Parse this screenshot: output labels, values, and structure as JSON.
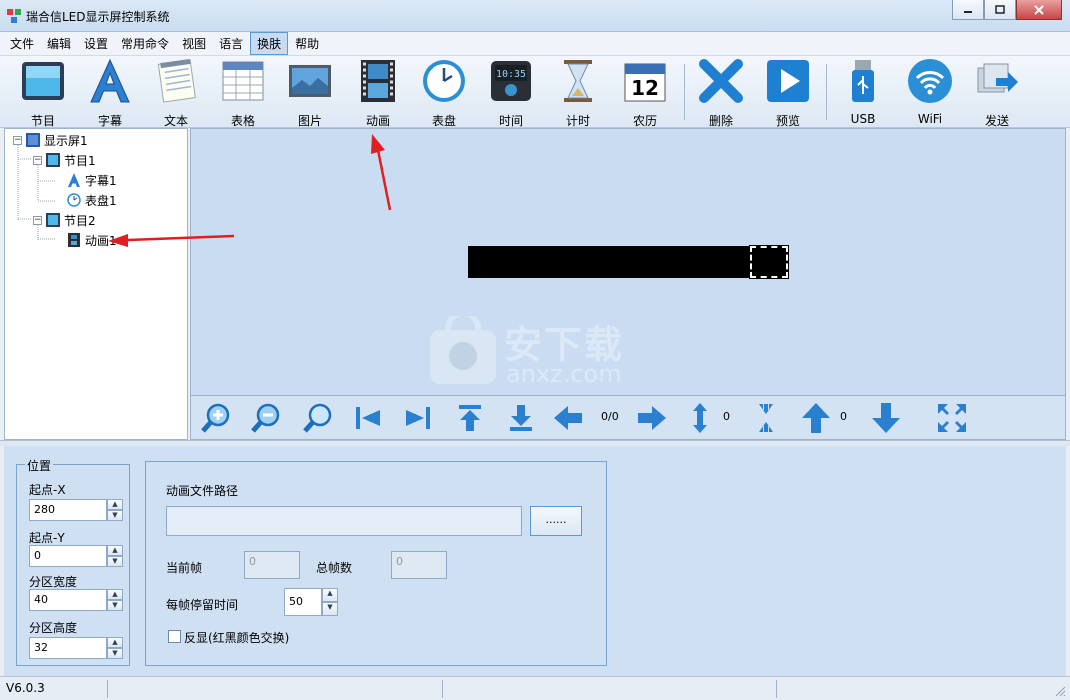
{
  "window": {
    "title": "瑞合信LED显示屏控制系统"
  },
  "menu": [
    "文件",
    "编辑",
    "设置",
    "常用命令",
    "视图",
    "语言",
    "换肤",
    "帮助"
  ],
  "toolbar": {
    "program": "节目",
    "subtitle": "字幕",
    "text": "文本",
    "table": "表格",
    "image": "图片",
    "animation": "动画",
    "clock": "表盘",
    "time": "时间",
    "timer": "计时",
    "lunar": "农历",
    "delete": "删除",
    "preview": "预览",
    "usb": "USB",
    "wifi": "WiFi",
    "send": "发送"
  },
  "tree": {
    "screen": "显示屏1",
    "program1": "节目1",
    "subtitle1": "字幕1",
    "clock1": "表盘1",
    "program2": "节目2",
    "animation1": "动画1"
  },
  "preview_nav": {
    "page": "0/0",
    "vertical": "0",
    "horizontal": "0"
  },
  "position": {
    "legend": "位置",
    "x_label": "起点-X",
    "x_value": "280",
    "y_label": "起点-Y",
    "y_value": "0",
    "width_label": "分区宽度",
    "width_value": "40",
    "height_label": "分区高度",
    "height_value": "32"
  },
  "animation_props": {
    "path_label": "动画文件路径",
    "browse": "......",
    "current_frame_label": "当前帧",
    "current_frame": "0",
    "total_frames_label": "总帧数",
    "total_frames": "0",
    "dwell_label": "每帧停留时间",
    "dwell_value": "50",
    "invert_label": "反显(红黑颜色交换)"
  },
  "status": {
    "version": "V6.0.3"
  },
  "watermark": {
    "line1": "安下载",
    "line2": "anxz.com"
  }
}
